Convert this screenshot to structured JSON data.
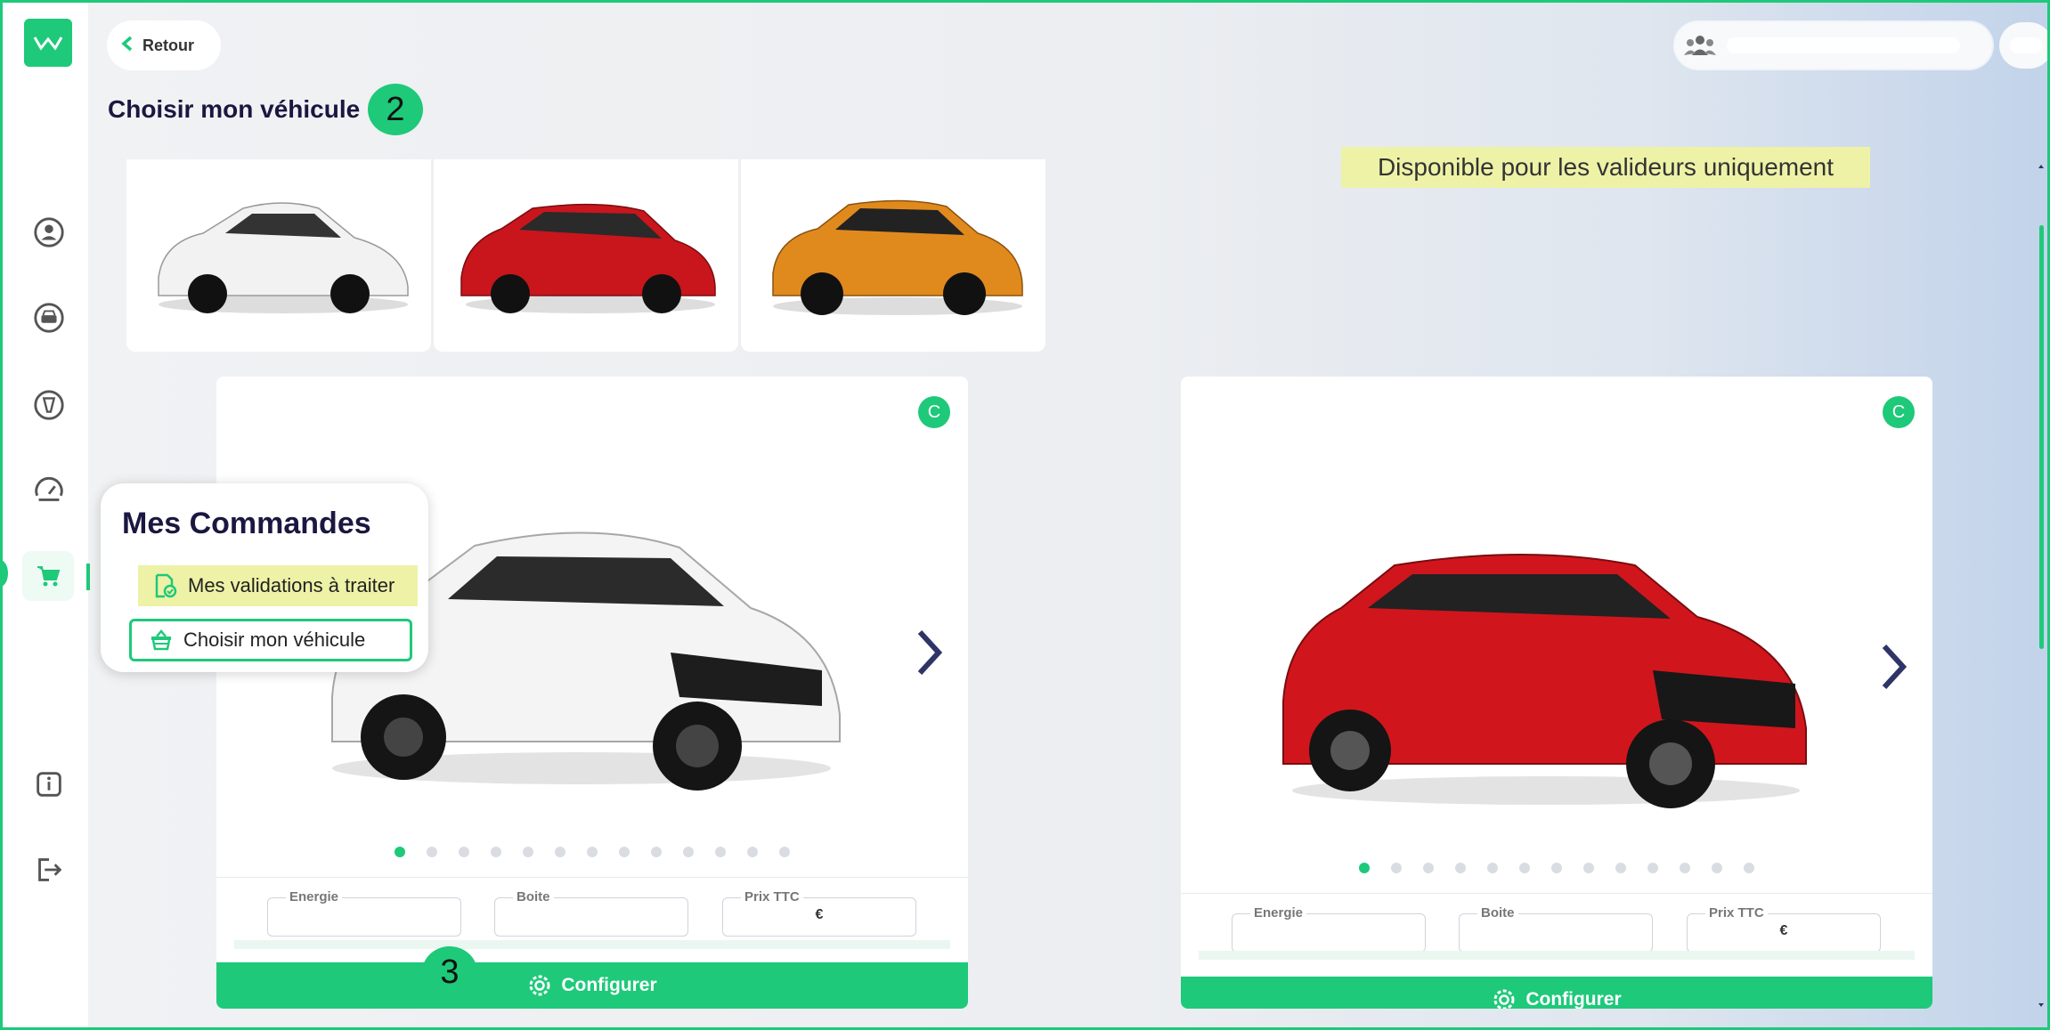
{
  "back_label": "Retour",
  "page_title": "Choisir mon véhicule",
  "steps": {
    "two": "2",
    "three": "3"
  },
  "banner": "Disponible pour les valideurs uniquement",
  "thumbnails": [
    {
      "color": "#ffffff"
    },
    {
      "color": "#c8161c"
    },
    {
      "color": "#e08a1e"
    }
  ],
  "cards": [
    {
      "badge": "C",
      "car_color": "#f4f4f4",
      "dots": 13,
      "fields": {
        "energie": "Energie",
        "boite": "Boite",
        "prix": "Prix TTC",
        "prix_value": "€"
      },
      "configure": "Configurer"
    },
    {
      "badge": "C",
      "car_color": "#d0161c",
      "dots": 13,
      "fields": {
        "energie": "Energie",
        "boite": "Boite",
        "prix": "Prix TTC",
        "prix_value": "€"
      },
      "configure": "Configurer"
    }
  ],
  "popover": {
    "title": "Mes Commandes",
    "item1": "Mes validations à traiter",
    "item2": "Choisir mon véhicule"
  },
  "icons": {
    "sidebar": [
      "user-circle-icon",
      "car-icon",
      "tire-icon",
      "speedometer-icon",
      "cart-icon",
      "info-icon",
      "logout-icon"
    ],
    "topbar": [
      "users-icon"
    ]
  },
  "colors": {
    "accent": "#1ec97a",
    "highlight": "#eef2a6",
    "title": "#1a1740"
  }
}
